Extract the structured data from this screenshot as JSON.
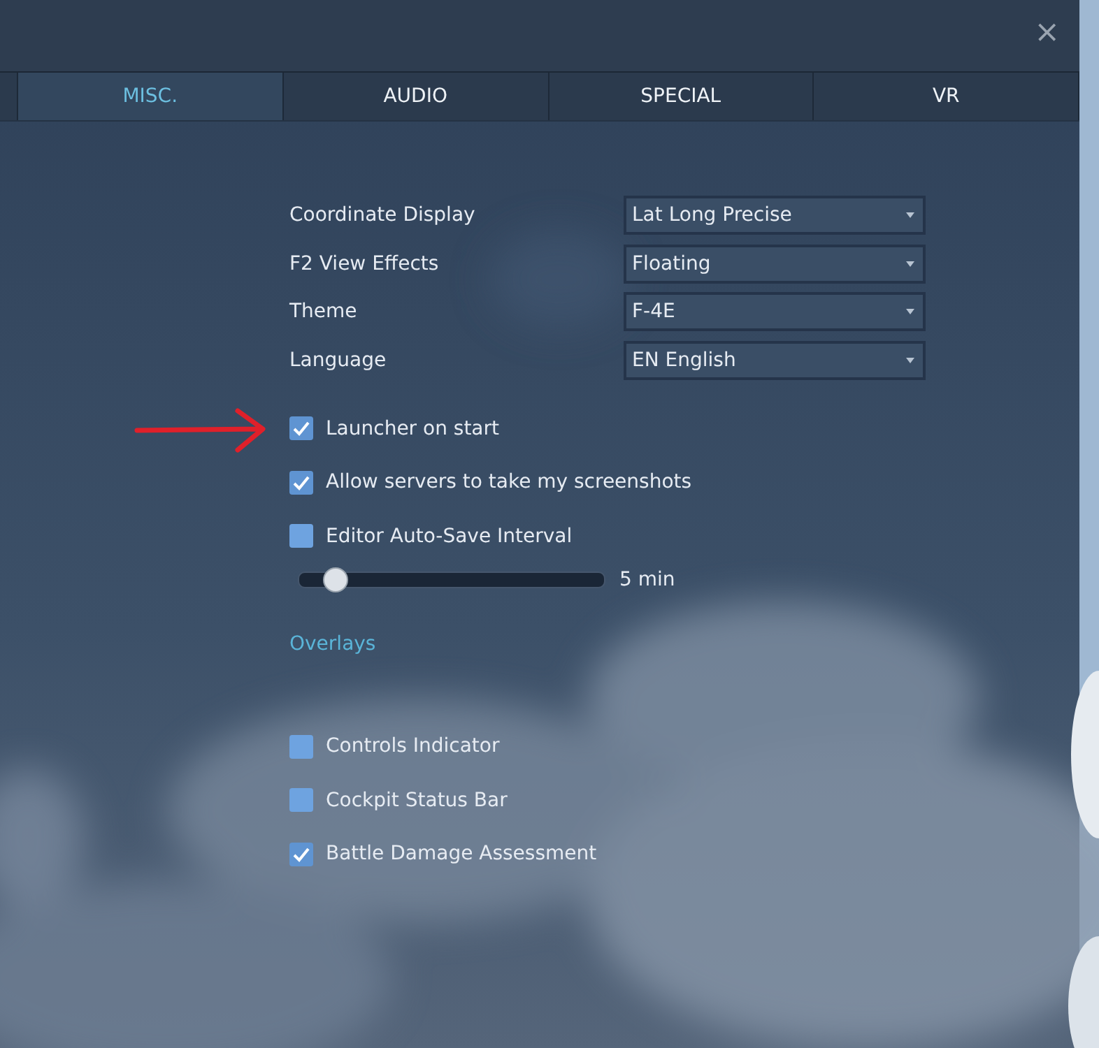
{
  "close": "×",
  "tabs": [
    {
      "label": "MISC.",
      "selected": true
    },
    {
      "label": "AUDIO",
      "selected": false
    },
    {
      "label": "SPECIAL",
      "selected": false
    },
    {
      "label": "VR",
      "selected": false
    }
  ],
  "dropdowns": [
    {
      "label": "Coordinate Display",
      "value": "Lat Long Precise"
    },
    {
      "label": "F2 View Effects",
      "value": "Floating"
    },
    {
      "label": "Theme",
      "value": "F-4E"
    },
    {
      "label": "Language",
      "value": "EN English"
    }
  ],
  "options": [
    {
      "kind": "checkbox",
      "label": "Launcher on start",
      "checked": true
    },
    {
      "kind": "checkbox",
      "label": "Allow servers to take my screenshots",
      "checked": true
    },
    {
      "kind": "checkbox",
      "label": "Editor Auto-Save Interval",
      "checked": false
    },
    {
      "kind": "slider",
      "level": 0.08,
      "reading": "5 min"
    }
  ],
  "overlays": {
    "title": "Overlays",
    "items": [
      {
        "label": "Controls Indicator",
        "checked": false
      },
      {
        "label": "Cockpit Status Bar",
        "checked": false
      },
      {
        "label": "Battle Damage Assessment",
        "checked": true
      }
    ]
  }
}
